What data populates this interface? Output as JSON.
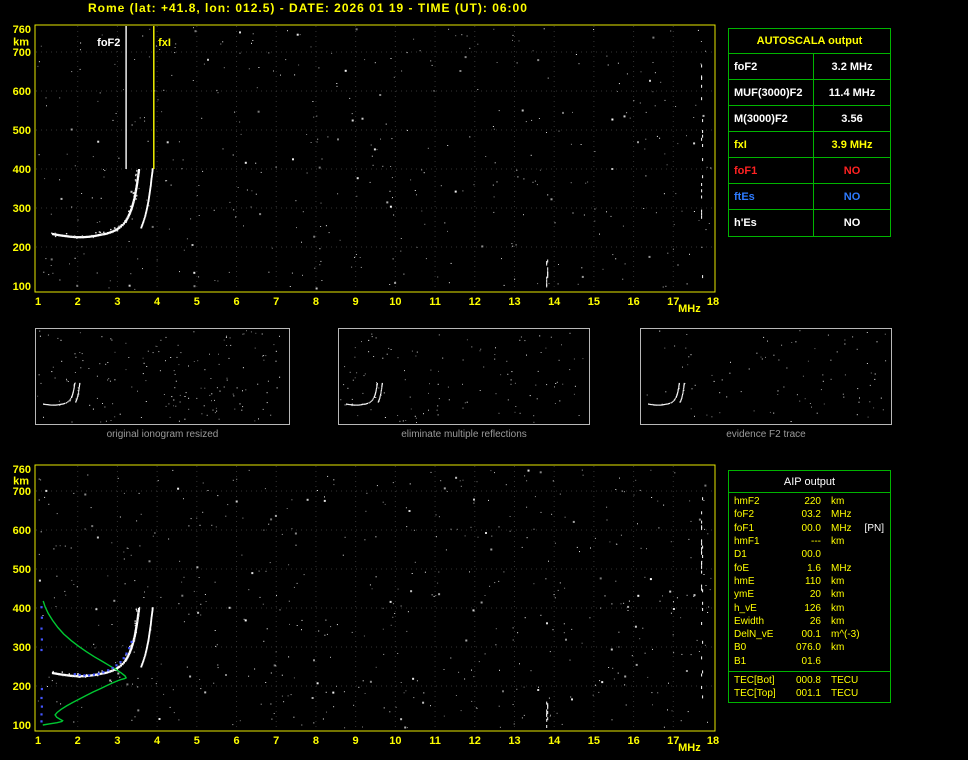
{
  "header": {
    "title": "Rome (lat: +41.8, lon: 012.5) - DATE: 2026 01 19 - TIME (UT): 06:00"
  },
  "colors": {
    "background": "#000000",
    "axis_yellow": "#ffff00",
    "plot_border_yellow": "#e8e800",
    "table_border_green": "#00b400",
    "trace_white": "#ffffff",
    "profile_green": "#00c832",
    "fitted_blue": "#4455ff",
    "no_red": "#ff2222",
    "es_blue": "#2e7bff",
    "caption_gray": "#9a9a9a"
  },
  "autoscala_table": {
    "title": "AUTOSCALA output",
    "rows": [
      {
        "label": "foF2",
        "value": "3.2 MHz",
        "color": "#ffffff"
      },
      {
        "label": "MUF(3000)F2",
        "value": "11.4 MHz",
        "color": "#ffffff"
      },
      {
        "label": "M(3000)F2",
        "value": "3.56",
        "color": "#ffffff"
      },
      {
        "label": "fxI",
        "value": "3.9 MHz",
        "color": "#ffff00"
      },
      {
        "label": "foF1",
        "value": "NO",
        "color": "#ff2222"
      },
      {
        "label": "ftEs",
        "value": "NO",
        "color": "#2e7bff"
      },
      {
        "label": "h'Es",
        "value": "NO",
        "color": "#ffffff"
      }
    ]
  },
  "aip_table": {
    "title": "AIP output",
    "rows": [
      {
        "label": "hmF2",
        "value": "220",
        "unit": "km",
        "flag": ""
      },
      {
        "label": "foF2",
        "value": "03.2",
        "unit": "MHz",
        "flag": ""
      },
      {
        "label": "foF1",
        "value": "00.0",
        "unit": "MHz",
        "flag": "[PN]"
      },
      {
        "label": "hmF1",
        "value": "---",
        "unit": "km",
        "flag": ""
      },
      {
        "label": "D1",
        "value": "00.0",
        "unit": "",
        "flag": ""
      },
      {
        "label": "foE",
        "value": "1.6",
        "unit": "MHz",
        "flag": ""
      },
      {
        "label": "hmE",
        "value": "110",
        "unit": "km",
        "flag": ""
      },
      {
        "label": "ymE",
        "value": "20",
        "unit": "km",
        "flag": ""
      },
      {
        "label": "h_vE",
        "value": "126",
        "unit": "km",
        "flag": ""
      },
      {
        "label": "Ewidth",
        "value": "26",
        "unit": "km",
        "flag": ""
      },
      {
        "label": "DelN_vE",
        "value": "00.1",
        "unit": "m^(-3)",
        "flag": ""
      },
      {
        "label": "B0",
        "value": "076.0",
        "unit": "km",
        "flag": ""
      },
      {
        "label": "B1",
        "value": "01.6",
        "unit": "",
        "flag": ""
      }
    ],
    "tec_rows": [
      {
        "label": "TEC[Bot]",
        "value": "000.8",
        "unit": "TECU"
      },
      {
        "label": "TEC[Top]",
        "value": "001.1",
        "unit": "TECU"
      }
    ]
  },
  "thumbnails": [
    {
      "caption": "original ionogram resized"
    },
    {
      "caption": "eliminate multiple reflections"
    },
    {
      "caption": "evidence F2 trace"
    }
  ],
  "chart_data": [
    {
      "name": "scaled-ionogram",
      "type": "scatter",
      "title": "ionogram with autoscaled characteristics",
      "xlabel": "MHz",
      "ylabel": "km",
      "xlim": [
        1,
        18
      ],
      "ylim": [
        84,
        769
      ],
      "x_ticks": [
        1,
        2,
        3,
        4,
        5,
        6,
        7,
        8,
        9,
        10,
        11,
        12,
        13,
        14,
        15,
        16,
        17,
        18
      ],
      "y_ticks": [
        760,
        700,
        600,
        500,
        400,
        300,
        200,
        100
      ],
      "grid": true,
      "markers": [
        {
          "label": "foF2",
          "freq": 3.2,
          "to_km": 400,
          "color": "#ffffff",
          "anchor": "end"
        },
        {
          "label": "fxI",
          "freq": 3.9,
          "to_km": 400,
          "color": "#ffff00",
          "anchor": "start"
        }
      ],
      "o_trace": [
        [
          1.35,
          236
        ],
        [
          1.5,
          233
        ],
        [
          1.65,
          231
        ],
        [
          1.8,
          229
        ],
        [
          1.95,
          228
        ],
        [
          2.1,
          228
        ],
        [
          2.25,
          229
        ],
        [
          2.4,
          231
        ],
        [
          2.55,
          234
        ],
        [
          2.7,
          237
        ],
        [
          2.82,
          241
        ],
        [
          2.93,
          246
        ],
        [
          3.02,
          252
        ],
        [
          3.1,
          259
        ],
        [
          3.17,
          267
        ],
        [
          3.23,
          277
        ],
        [
          3.28,
          288
        ],
        [
          3.33,
          301
        ],
        [
          3.37,
          315
        ],
        [
          3.41,
          331
        ],
        [
          3.44,
          348
        ],
        [
          3.47,
          366
        ],
        [
          3.49,
          382
        ],
        [
          3.51,
          396
        ],
        [
          3.52,
          404
        ]
      ],
      "x_trace": [
        [
          3.58,
          252
        ],
        [
          3.63,
          266
        ],
        [
          3.68,
          282
        ],
        [
          3.72,
          300
        ],
        [
          3.76,
          320
        ],
        [
          3.79,
          341
        ],
        [
          3.82,
          362
        ],
        [
          3.84,
          381
        ],
        [
          3.86,
          396
        ],
        [
          3.87,
          405
        ]
      ],
      "rfi_lines": [
        {
          "freq": 13.8,
          "km_from": 100,
          "km_to": 168,
          "density": 0.7
        },
        {
          "freq": 17.7,
          "km_from": 100,
          "km_to": 700,
          "density": 0.15
        }
      ]
    },
    {
      "name": "profile-ionogram",
      "type": "scatter",
      "title": "ionogram with electron density profile",
      "xlabel": "MHz",
      "ylabel": "km",
      "xlim": [
        1,
        18
      ],
      "ylim": [
        84,
        769
      ],
      "x_ticks": [
        1,
        2,
        3,
        4,
        5,
        6,
        7,
        8,
        9,
        10,
        11,
        12,
        13,
        14,
        15,
        16,
        17,
        18
      ],
      "y_ticks": [
        760,
        700,
        600,
        500,
        400,
        300,
        200,
        100
      ],
      "grid": true,
      "o_trace": [
        [
          1.35,
          236
        ],
        [
          1.5,
          233
        ],
        [
          1.65,
          231
        ],
        [
          1.8,
          229
        ],
        [
          1.95,
          228
        ],
        [
          2.1,
          228
        ],
        [
          2.25,
          229
        ],
        [
          2.4,
          231
        ],
        [
          2.55,
          234
        ],
        [
          2.7,
          237
        ],
        [
          2.82,
          241
        ],
        [
          2.93,
          246
        ],
        [
          3.02,
          252
        ],
        [
          3.1,
          259
        ],
        [
          3.17,
          267
        ],
        [
          3.23,
          277
        ],
        [
          3.28,
          288
        ],
        [
          3.33,
          301
        ],
        [
          3.37,
          315
        ],
        [
          3.41,
          331
        ],
        [
          3.44,
          348
        ],
        [
          3.47,
          366
        ],
        [
          3.49,
          382
        ],
        [
          3.51,
          396
        ],
        [
          3.52,
          404
        ]
      ],
      "x_trace": [
        [
          3.58,
          252
        ],
        [
          3.63,
          266
        ],
        [
          3.68,
          282
        ],
        [
          3.72,
          300
        ],
        [
          3.76,
          320
        ],
        [
          3.79,
          341
        ],
        [
          3.82,
          362
        ],
        [
          3.84,
          381
        ],
        [
          3.86,
          396
        ],
        [
          3.87,
          405
        ]
      ],
      "profile": [
        [
          1.12,
          100
        ],
        [
          1.3,
          103
        ],
        [
          1.48,
          106
        ],
        [
          1.6,
          109
        ],
        [
          1.62,
          111
        ],
        [
          1.55,
          115
        ],
        [
          1.47,
          120
        ],
        [
          1.43,
          126
        ],
        [
          1.48,
          132
        ],
        [
          1.58,
          140
        ],
        [
          1.72,
          149
        ],
        [
          1.88,
          158
        ],
        [
          2.05,
          167
        ],
        [
          2.22,
          176
        ],
        [
          2.4,
          185
        ],
        [
          2.57,
          193
        ],
        [
          2.73,
          201
        ],
        [
          2.88,
          208
        ],
        [
          3.0,
          213
        ],
        [
          3.1,
          217
        ],
        [
          3.18,
          219
        ],
        [
          3.22,
          221
        ],
        [
          3.19,
          226
        ],
        [
          3.1,
          233
        ],
        [
          2.97,
          242
        ],
        [
          2.8,
          252
        ],
        [
          2.62,
          263
        ],
        [
          2.42,
          275
        ],
        [
          2.22,
          288
        ],
        [
          2.02,
          302
        ],
        [
          1.83,
          317
        ],
        [
          1.65,
          333
        ],
        [
          1.5,
          350
        ],
        [
          1.37,
          368
        ],
        [
          1.26,
          386
        ],
        [
          1.18,
          403
        ],
        [
          1.13,
          418
        ]
      ],
      "fitted_points": [
        [
          1.9,
          233
        ],
        [
          2.02,
          231
        ],
        [
          2.14,
          230
        ],
        [
          2.26,
          230
        ],
        [
          2.38,
          232
        ],
        [
          2.5,
          234
        ],
        [
          2.62,
          238
        ],
        [
          2.74,
          243
        ],
        [
          2.85,
          249
        ],
        [
          2.95,
          256
        ],
        [
          3.05,
          264
        ],
        [
          3.13,
          274
        ],
        [
          3.2,
          286
        ],
        [
          3.27,
          300
        ],
        [
          3.33,
          316
        ],
        [
          1.06,
          112
        ],
        [
          1.06,
          130
        ],
        [
          1.07,
          150
        ],
        [
          1.06,
          172
        ],
        [
          1.07,
          195
        ],
        [
          1.06,
          295
        ],
        [
          1.07,
          322
        ],
        [
          1.06,
          350
        ],
        [
          1.07,
          378
        ],
        [
          1.06,
          405
        ]
      ],
      "rfi_lines": [
        {
          "freq": 13.8,
          "km_from": 100,
          "km_to": 160,
          "density": 0.6
        },
        {
          "freq": 17.7,
          "km_from": 100,
          "km_to": 700,
          "density": 0.18
        }
      ]
    }
  ]
}
